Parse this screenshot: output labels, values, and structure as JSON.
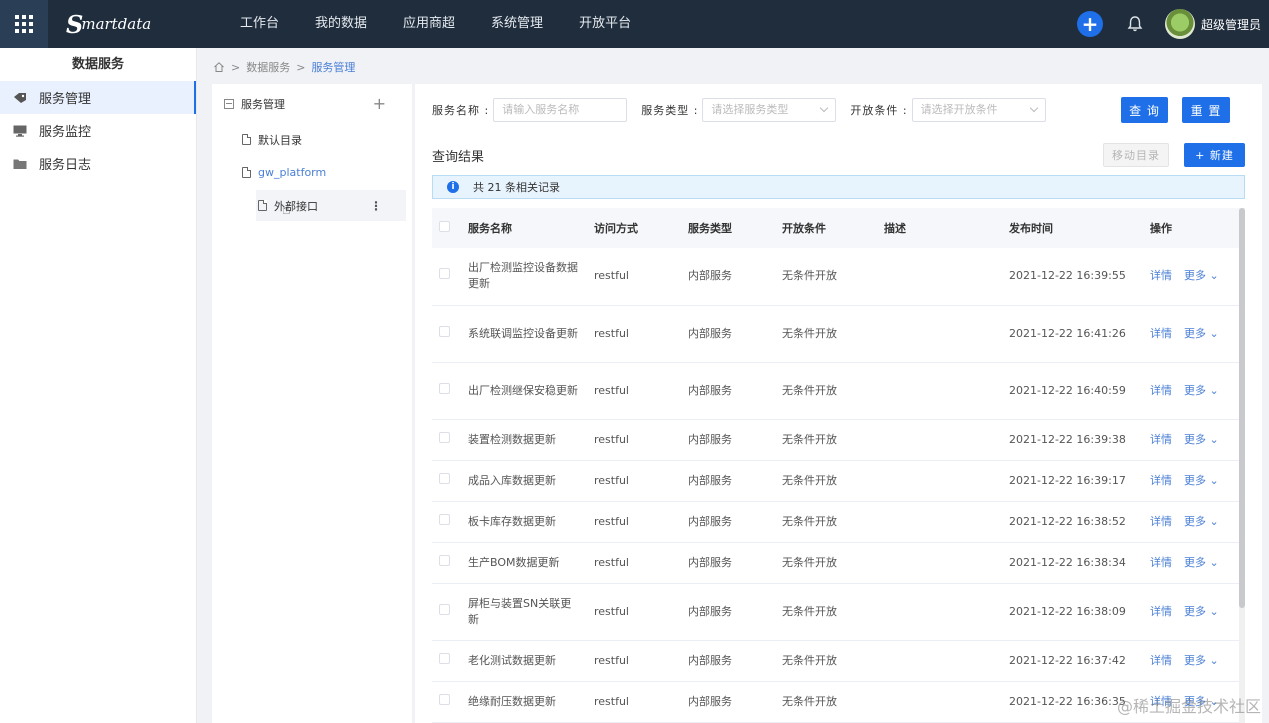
{
  "topbar": {
    "logo_text": "martdata",
    "logo_letter": "S",
    "nav": [
      "工作台",
      "我的数据",
      "应用商超",
      "系统管理",
      "开放平台"
    ],
    "add_icon": "plus-icon",
    "bell_icon": "bell-icon",
    "user_name": "超级管理员"
  },
  "sidebar": {
    "title": "数据服务",
    "items": [
      {
        "label": "服务管理",
        "icon": "tag-icon",
        "active": true
      },
      {
        "label": "服务监控",
        "icon": "monitor-icon",
        "active": false
      },
      {
        "label": "服务日志",
        "icon": "folder-icon",
        "active": false
      }
    ]
  },
  "breadcrumb": {
    "items": [
      "数据服务",
      "服务管理"
    ],
    "separator": ">"
  },
  "tree": {
    "root": "服务管理",
    "nodes": [
      {
        "label": "默认目录"
      },
      {
        "label": "gw_platform"
      },
      {
        "label": "外部接口"
      }
    ]
  },
  "search": {
    "name_label": "服务名称 :",
    "name_placeholder": "请输入服务名称",
    "type_label": "服务类型 :",
    "type_placeholder": "请选择服务类型",
    "cond_label": "开放条件 :",
    "cond_placeholder": "请选择开放条件",
    "query_btn": "查 询",
    "reset_btn": "重 置"
  },
  "results": {
    "title": "查询结果",
    "move_btn": "移动目录",
    "new_btn": "+ 新建",
    "info": "共 21 条相关记录"
  },
  "table": {
    "headers": [
      "服务名称",
      "访问方式",
      "服务类型",
      "开放条件",
      "描述",
      "发布时间",
      "操作"
    ],
    "detail_label": "详情",
    "more_label": "更多",
    "rows": [
      {
        "name": "出厂检测监控设备数据更新",
        "method": "restful",
        "type": "内部服务",
        "cond": "无条件开放",
        "desc": "",
        "time": "2021-12-22 16:39:55"
      },
      {
        "name": "系统联调监控设备更新",
        "method": "restful",
        "type": "内部服务",
        "cond": "无条件开放",
        "desc": "",
        "time": "2021-12-22 16:41:26"
      },
      {
        "name": "出厂检测继保安稳更新",
        "method": "restful",
        "type": "内部服务",
        "cond": "无条件开放",
        "desc": "",
        "time": "2021-12-22 16:40:59"
      },
      {
        "name": "装置检测数据更新",
        "method": "restful",
        "type": "内部服务",
        "cond": "无条件开放",
        "desc": "",
        "time": "2021-12-22 16:39:38"
      },
      {
        "name": "成品入库数据更新",
        "method": "restful",
        "type": "内部服务",
        "cond": "无条件开放",
        "desc": "",
        "time": "2021-12-22 16:39:17"
      },
      {
        "name": "板卡库存数据更新",
        "method": "restful",
        "type": "内部服务",
        "cond": "无条件开放",
        "desc": "",
        "time": "2021-12-22 16:38:52"
      },
      {
        "name": "生产BOM数据更新",
        "method": "restful",
        "type": "内部服务",
        "cond": "无条件开放",
        "desc": "",
        "time": "2021-12-22 16:38:34"
      },
      {
        "name": "屏柜与装置SN关联更新",
        "method": "restful",
        "type": "内部服务",
        "cond": "无条件开放",
        "desc": "",
        "time": "2021-12-22 16:38:09"
      },
      {
        "name": "老化测试数据更新",
        "method": "restful",
        "type": "内部服务",
        "cond": "无条件开放",
        "desc": "",
        "time": "2021-12-22 16:37:42"
      },
      {
        "name": "绝缘耐压数据更新",
        "method": "restful",
        "type": "内部服务",
        "cond": "无条件开放",
        "desc": "",
        "time": "2021-12-22 16:36:35"
      }
    ]
  },
  "watermark": "@稀土掘金技术社区",
  "colors": {
    "topbar": "#1f2d3d",
    "primary": "#1e6fe8",
    "link": "#4a7fd6"
  }
}
